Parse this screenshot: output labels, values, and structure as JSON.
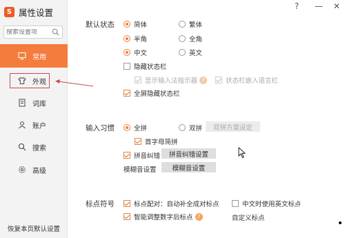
{
  "app": {
    "logo_letter": "S",
    "title": "属性设置"
  },
  "window_controls": {
    "help": "?",
    "minimize": "—",
    "close": "✕"
  },
  "search": {
    "placeholder": "搜索设置项"
  },
  "nav": {
    "items": [
      {
        "id": "common",
        "label": "常用",
        "icon": "monitor-icon",
        "active": true
      },
      {
        "id": "appearance",
        "label": "外观",
        "icon": "shirt-icon",
        "active": false
      },
      {
        "id": "dictionary",
        "label": "词库",
        "icon": "book-icon",
        "active": false
      },
      {
        "id": "account",
        "label": "账户",
        "icon": "user-icon",
        "active": false
      },
      {
        "id": "search",
        "label": "搜索",
        "icon": "search-icon",
        "active": false
      },
      {
        "id": "advanced",
        "label": "高级",
        "icon": "gear-icon",
        "active": false
      }
    ],
    "restore_label": "恢复本页默认设置"
  },
  "default_state": {
    "label": "默认状态",
    "script": {
      "simplified": "简体",
      "traditional": "繁体",
      "selected": "简体"
    },
    "width": {
      "half": "半角",
      "full": "全角",
      "selected": "半角"
    },
    "language": {
      "chinese": "中文",
      "english": "英文",
      "selected": "中文"
    },
    "hide_status_bar": {
      "label": "隐藏状态栏",
      "checked": false
    },
    "show_ime_indicator": {
      "label": "显示输入法指示器",
      "checked": true,
      "disabled": true
    },
    "embed_status_bar": {
      "label": "状态栏嵌入语言栏",
      "checked": true,
      "disabled": true
    },
    "fullscreen_hide": {
      "label": "全屏隐藏状态栏",
      "checked": true
    }
  },
  "input_habit": {
    "label": "输入习惯",
    "full_pinyin": "全拼",
    "double_pinyin": "双拼",
    "selected": "全拼",
    "double_scheme_button": "双拼方案设定",
    "initial_pinyin": {
      "label": "首字母简拼",
      "checked": true
    },
    "pinyin_correction": {
      "label": "拼音纠错",
      "checked": true
    },
    "pinyin_correction_button": "拼音纠错设置",
    "fuzzy_label": "模糊音设置",
    "fuzzy_button": "模糊音设置"
  },
  "punctuation": {
    "label": "标点符号",
    "pair_completion": {
      "label": "标点配对：自动补全成对标点",
      "checked": true
    },
    "chinese_half_width": {
      "label": "中文时使用英文标点",
      "checked": false
    },
    "smart_adjust": {
      "label": "智能调整数字后标点",
      "checked": true
    },
    "custom_label": "自定义标点"
  },
  "colors": {
    "accent": "#f47c3c",
    "annotation_red": "#c94a4a"
  }
}
